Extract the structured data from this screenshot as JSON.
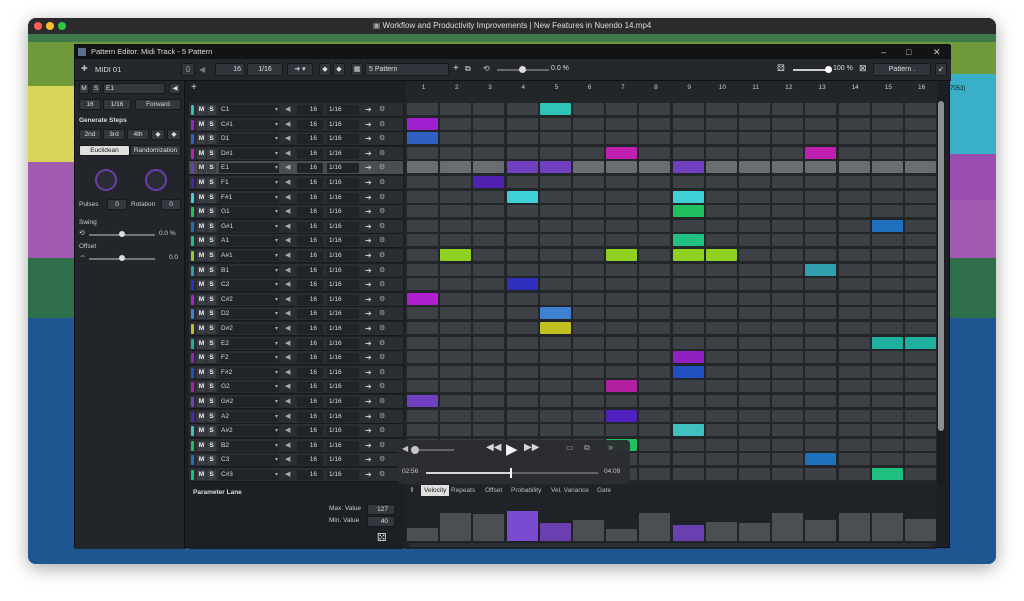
{
  "window_title": "Workflow and Productivity Improvements | New Features in Nuendo 14.mp4",
  "editor_title": "Pattern Editor: Midi Track - 5 Pattern",
  "toolbar": {
    "track_name": "MIDI 01",
    "steps": "16",
    "quantize": "1/16",
    "pattern_name": "5 Pattern",
    "swing_value": "0.0 %",
    "zoom_value": "100 %",
    "pattern_menu": "Pattern ."
  },
  "side_label": "7053)",
  "left_panel": {
    "selected_note": "E1",
    "steps": "16",
    "quantize": "1/16",
    "direction": "Forward",
    "generate_steps": "Generate Steps",
    "step_buttons": [
      "2nd",
      "3rd",
      "4th"
    ],
    "tabs": [
      "Euclidean",
      "Randomization"
    ],
    "pulses_label": "Pulses",
    "pulses_value": "0",
    "rotation_label": "Rotation",
    "rotation_value": "0",
    "swing_label": "Swing",
    "swing_value": "0.0 %",
    "offset_label": "Offset",
    "offset_value": "0.0"
  },
  "track_defaults": {
    "mute": "M",
    "solo": "S",
    "steps": "16",
    "quantize": "1/16"
  },
  "tracks": [
    {
      "note": "C1",
      "color": "#2ec4b6"
    },
    {
      "note": "C#1",
      "color": "#a020d0"
    },
    {
      "note": "D1",
      "color": "#3060c0"
    },
    {
      "note": "D#1",
      "color": "#c020b0"
    },
    {
      "note": "E1",
      "color": "#7040c0"
    },
    {
      "note": "F1",
      "color": "#5020b0"
    },
    {
      "note": "F#1",
      "color": "#40d0d8"
    },
    {
      "note": "G1",
      "color": "#20c060"
    },
    {
      "note": "G#1",
      "color": "#2070c0"
    },
    {
      "note": "A1",
      "color": "#20c080"
    },
    {
      "note": "A#1",
      "color": "#90d020"
    },
    {
      "note": "B1",
      "color": "#30a0b0"
    },
    {
      "note": "C2",
      "color": "#3030c0"
    },
    {
      "note": "C#2",
      "color": "#b020d0"
    },
    {
      "note": "D2",
      "color": "#4080d0"
    },
    {
      "note": "D#2",
      "color": "#c0c020"
    },
    {
      "note": "E2",
      "color": "#20b0a0"
    },
    {
      "note": "F2",
      "color": "#9020c0"
    },
    {
      "note": "F#2",
      "color": "#2050c0"
    },
    {
      "note": "G2",
      "color": "#b020a0"
    },
    {
      "note": "G#2",
      "color": "#7040c0"
    },
    {
      "note": "A2",
      "color": "#5020c0"
    },
    {
      "note": "A#2",
      "color": "#40c0c0"
    },
    {
      "note": "B2",
      "color": "#20c060"
    },
    {
      "note": "C3",
      "color": "#2070c0"
    },
    {
      "note": "C#3",
      "color": "#20c080"
    }
  ],
  "step_numbers": [
    "1",
    "2",
    "3",
    "4",
    "5",
    "6",
    "7",
    "8",
    "9",
    "10",
    "11",
    "12",
    "13",
    "14",
    "15",
    "16"
  ],
  "active_steps": [
    {
      "row": 0,
      "step": 5
    },
    {
      "row": 1,
      "step": 1
    },
    {
      "row": 2,
      "step": 1
    },
    {
      "row": 3,
      "step": 7
    },
    {
      "row": 3,
      "step": 13
    },
    {
      "row": 5,
      "step": 3
    },
    {
      "row": 6,
      "step": 4
    },
    {
      "row": 6,
      "step": 9
    },
    {
      "row": 7,
      "step": 9
    },
    {
      "row": 8,
      "step": 15
    },
    {
      "row": 9,
      "step": 9
    },
    {
      "row": 10,
      "step": 2
    },
    {
      "row": 10,
      "step": 7
    },
    {
      "row": 10,
      "step": 9
    },
    {
      "row": 10,
      "step": 10
    },
    {
      "row": 11,
      "step": 13
    },
    {
      "row": 12,
      "step": 4
    },
    {
      "row": 13,
      "step": 1
    },
    {
      "row": 14,
      "step": 5
    },
    {
      "row": 15,
      "step": 5
    },
    {
      "row": 16,
      "step": 15
    },
    {
      "row": 16,
      "step": 16
    },
    {
      "row": 17,
      "step": 9
    },
    {
      "row": 18,
      "step": 9
    },
    {
      "row": 19,
      "step": 7
    },
    {
      "row": 20,
      "step": 1
    },
    {
      "row": 21,
      "step": 7
    },
    {
      "row": 22,
      "step": 9
    },
    {
      "row": 23,
      "step": 7
    },
    {
      "row": 24,
      "step": 13
    },
    {
      "row": 25,
      "step": 15
    }
  ],
  "selected_row_steps": [
    4,
    5,
    9
  ],
  "transport": {
    "elapsed": "02:56",
    "remaining": "04:09",
    "progress": 0.49
  },
  "parameter_lane": {
    "title": "Parameter Lane",
    "max_label": "Max. Value",
    "max_value": "127",
    "min_label": "Min. Value",
    "min_value": "40",
    "tabs": [
      "Velocity",
      "Repeats",
      "Offset",
      "Probability",
      "Vel. Variance",
      "Gate"
    ],
    "active_tab": "Velocity",
    "velocity_levels": [
      0.45,
      0.95,
      0.9,
      1.0,
      0.6,
      0.7,
      0.4,
      0.95,
      0.55,
      0.65,
      0.6,
      0.95,
      0.7,
      0.95,
      0.95,
      0.75
    ]
  }
}
